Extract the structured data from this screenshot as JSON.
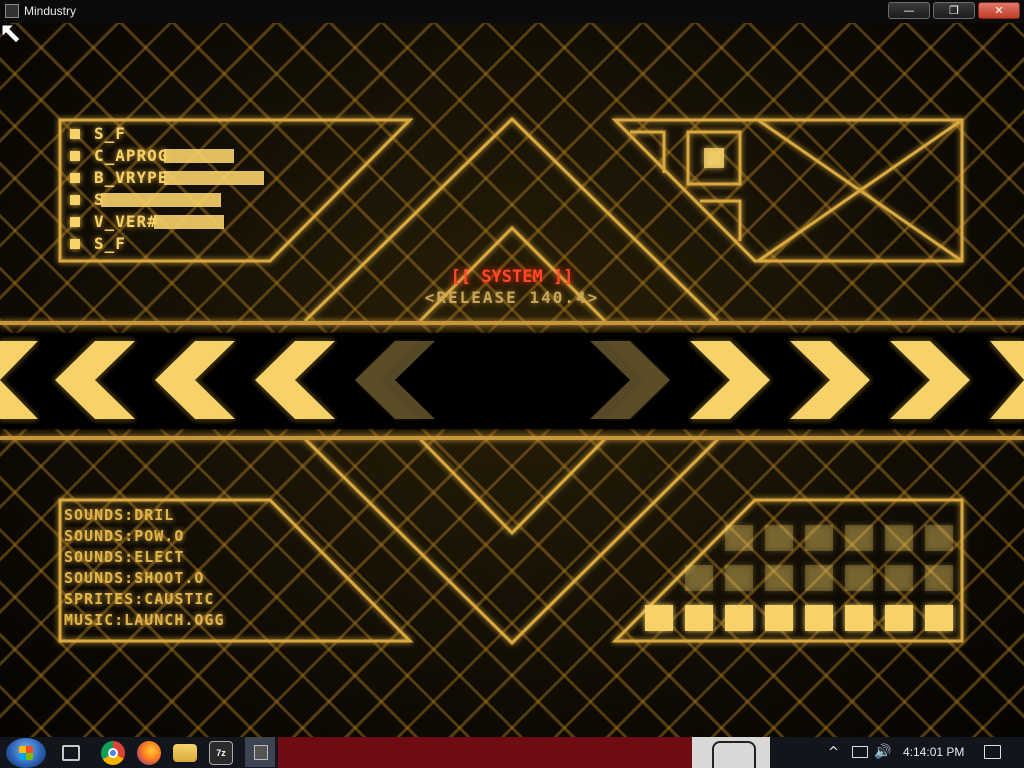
{
  "window": {
    "title": "Mindustry",
    "controls": [
      "minimize",
      "maximize",
      "close"
    ]
  },
  "game": {
    "left_list": [
      "S_F",
      "C_APROG",
      "B_VRYPE",
      "S",
      "V_VER#",
      "S_F"
    ],
    "system_label": "[[ SYSTEM ]]",
    "release_label": "<RELEASE 140.4>",
    "asset_list": [
      "SOUNDS:DRIL",
      "SOUNDS:POW.O",
      "SOUNDS:ELECT",
      "SOUNDS:SHOOT.O",
      "SPRITES:CAUSTIC",
      "MUSIC:LAUNCH.OGG"
    ],
    "colors": {
      "accent": "#f7d269",
      "grid": "#aa781e",
      "system_red": "#ff4a2a",
      "background": "#0a0804"
    },
    "loading_progress": 0.0
  },
  "taskbar": {
    "start_icon": "windows-start-icon",
    "pinned": [
      "task-view-icon",
      "chrome-icon",
      "firefox-icon",
      "file-explorer-icon",
      "7zip-icon",
      "mindustry-icon"
    ],
    "tray": {
      "chevron": "^",
      "volume_icon": "🔊",
      "clock": "4:14:01 PM"
    }
  }
}
